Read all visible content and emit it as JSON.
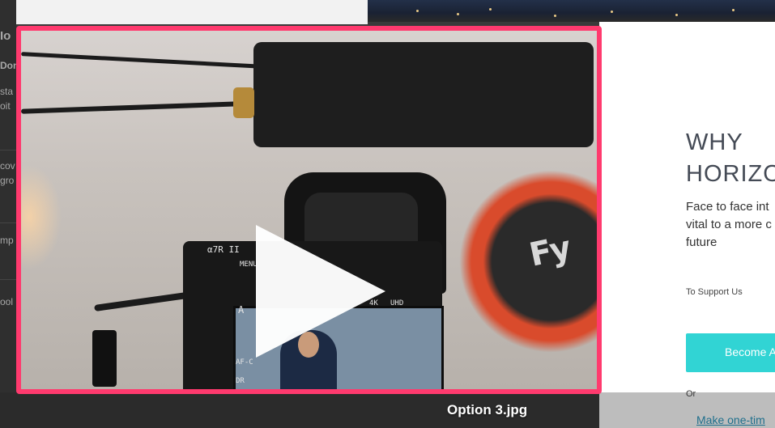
{
  "background_page": {
    "left_fragments": [
      "Io",
      "Don",
      "sta",
      "oit",
      "cov",
      "gro",
      "mp",
      "ool"
    ],
    "heading": [
      "WHY",
      "HORIZO"
    ],
    "intro": [
      "Face to face int",
      "vital to a more c",
      "future"
    ],
    "support_label": "To Support Us",
    "become_button": "Become A",
    "or_label": "Or",
    "one_time_link": "Make one-tim"
  },
  "preview": {
    "file_caption": "Option 3.jpg",
    "border_color": "#ff3a6e",
    "play_icon": "play-icon",
    "camera_labels": [
      "α7R II",
      "MENU",
      "A",
      "AF-C",
      "DR",
      "4K",
      "UHD"
    ],
    "gimbal_logo": "Fy"
  }
}
